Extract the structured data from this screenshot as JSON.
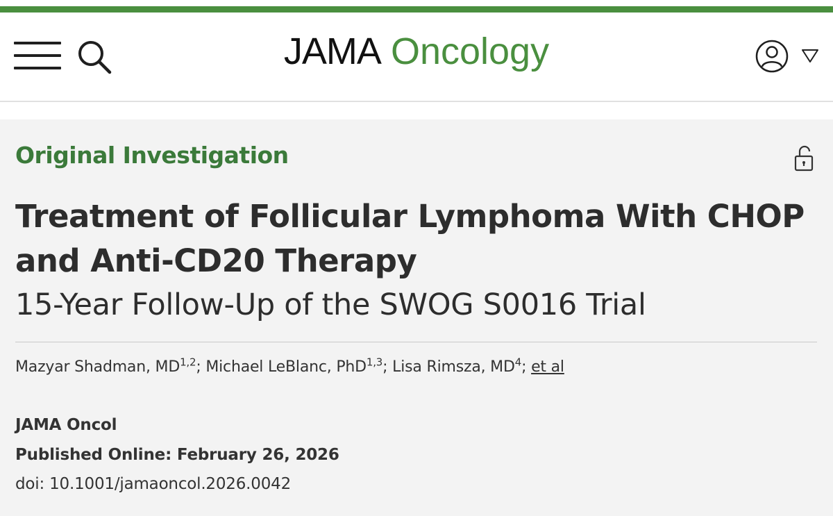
{
  "colors": {
    "brand_green": "#4a8f3f",
    "heading_green": "#3b7a3a",
    "text_dark": "#2d2d2d",
    "background_gray": "#f3f3f3"
  },
  "header": {
    "logo_primary": "JAMA",
    "logo_secondary": "Oncology",
    "menu_icon": "hamburger-menu-icon",
    "search_icon": "search-icon",
    "user_icon": "user-account-icon",
    "dropdown_icon": "triangle-down-icon"
  },
  "article": {
    "type": "Original Investigation",
    "access_icon": "unlock-icon",
    "title_line1": "Treatment of Follicular Lymphoma With CHOP",
    "title_line2": "and Anti-CD20 Therapy",
    "subtitle": "15-Year Follow-Up of the SWOG S0016 Trial",
    "authors": [
      {
        "name": "Mazyar Shadman, MD",
        "affiliations": "1,2",
        "separator": ";"
      },
      {
        "name": "Michael LeBlanc, PhD",
        "affiliations": "1,3",
        "separator": ";"
      },
      {
        "name": "Lisa Rimsza, MD",
        "affiliations": "4",
        "separator": ";"
      }
    ],
    "et_al": "et al",
    "journal": "JAMA Oncol",
    "published": "Published Online: February 26, 2026",
    "doi": "doi: 10.1001/jamaoncol.2026.0042"
  }
}
